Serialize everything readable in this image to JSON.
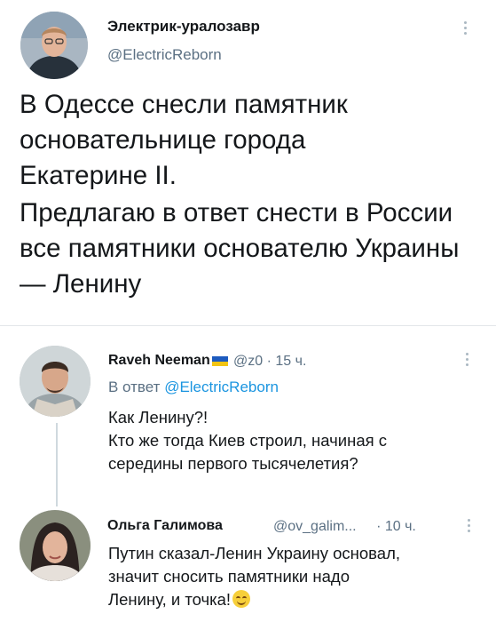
{
  "tweet": {
    "author_name": "Электрик-уралозавр",
    "author_handle": "@ElectricReborn",
    "paragraphs": [
      "В Одессе снесли памятник основательнице города Екатерине II.",
      "Предлагаю в ответ снести в России все памятники основателю Украины — Ленину"
    ]
  },
  "replies": [
    {
      "author_name": "Raveh Neeman",
      "author_handle": "@z0",
      "separator": "·",
      "time": "15 ч.",
      "reply_to_label": "В ответ",
      "reply_to_handle": "@ElectricReborn",
      "lines": [
        "Как Ленину?!",
        "Кто же тогда Киев строил, начиная с",
        "середины первого тысячелетия?"
      ]
    },
    {
      "author_name": "Ольга Галимова",
      "author_handle": "@ov_galim...",
      "separator": "·",
      "time": "10 ч.",
      "lines": [
        "Путин сказал-Ленин Украину основал,",
        "значит сносить памятники надо",
        "Ленину, и точка!"
      ]
    }
  ],
  "icons": {
    "more": "more-vertical-icon",
    "flag": "ukraine-flag-icon",
    "emoji": "smiling-face-icon"
  },
  "colors": {
    "text": "#14171a",
    "secondary": "#5b7083",
    "link": "#1b95e0",
    "divider": "#e3e6e9"
  }
}
